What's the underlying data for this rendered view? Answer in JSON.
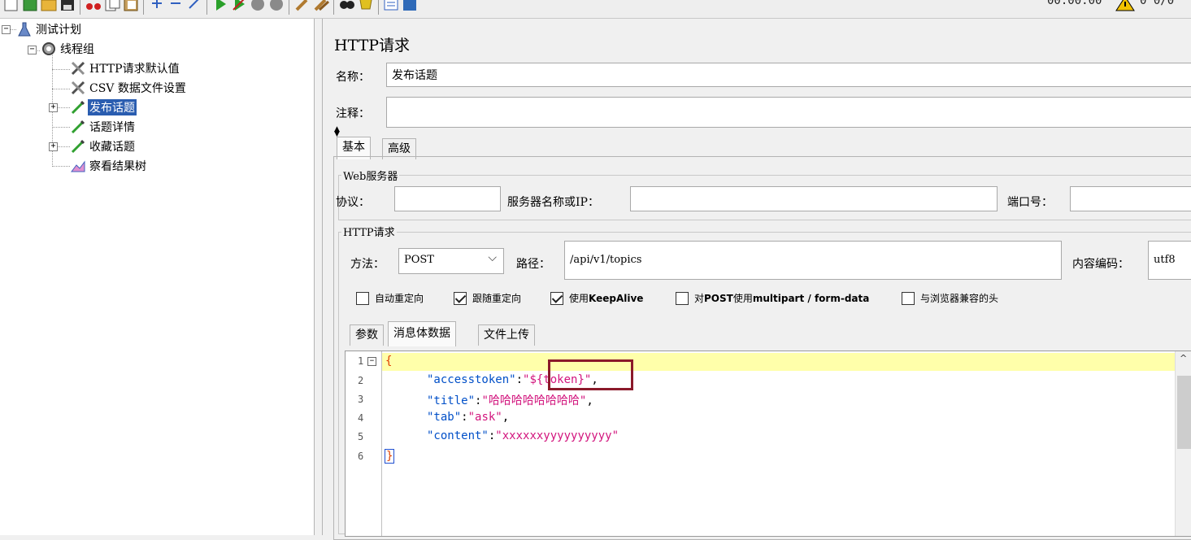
{
  "toolbar": {
    "timer": "00:00:00",
    "counter": "0 0/0",
    "icons": [
      "new-icon",
      "templates-icon",
      "open-icon",
      "save-icon",
      "cut-icon",
      "copy-icon",
      "paste-icon",
      "expand-icon",
      "collapse-icon",
      "toggle-icon",
      "start-icon",
      "start-no-pause-icon",
      "stop-icon",
      "shutdown-icon",
      "clear-icon",
      "clear-all-icon",
      "search-icon",
      "reset-search-icon",
      "function-helper-icon",
      "help-icon"
    ]
  },
  "tree": {
    "items": [
      {
        "label": "测试计划",
        "icon": "test-plan-icon"
      },
      {
        "label": "线程组",
        "icon": "thread-group-icon"
      },
      {
        "label": "HTTP请求默认值",
        "icon": "config-element-icon"
      },
      {
        "label": "CSV 数据文件设置",
        "icon": "config-element-icon"
      },
      {
        "label": "发布话题",
        "icon": "sampler-icon"
      },
      {
        "label": "话题详情",
        "icon": "sampler-icon"
      },
      {
        "label": "收藏话题",
        "icon": "sampler-icon"
      },
      {
        "label": "察看结果树",
        "icon": "listener-icon"
      }
    ]
  },
  "panel": {
    "title": "HTTP请求",
    "name_label": "名称：",
    "name_value": "发布话题",
    "comment_label": "注释：",
    "comment_value": "",
    "tabs": [
      "基本",
      "高级"
    ],
    "web_server": {
      "group_title": "Web服务器",
      "protocol_label": "协议：",
      "protocol_value": "",
      "server_label": "服务器名称或IP：",
      "server_value": "",
      "port_label": "端口号：",
      "port_value": ""
    },
    "http_request": {
      "group_title": "HTTP请求",
      "method_label": "方法：",
      "method_value": "POST",
      "path_label": "路径：",
      "path_value": "/api/v1/topics",
      "encoding_label": "内容编码：",
      "encoding_value": "utf8"
    },
    "checkboxes": [
      {
        "label": "自动重定向",
        "checked": false
      },
      {
        "label": "跟随重定向",
        "checked": true
      },
      {
        "label_prefix": "使用 ",
        "label_bold": "KeepAlive",
        "checked": true
      },
      {
        "label_prefix": "对",
        "label_bold": "POST",
        "label_mid": "使用",
        "label_bold2": "multipart / form-data",
        "checked": false
      },
      {
        "label": "与浏览器兼容的头",
        "checked": false
      }
    ],
    "body_tabs": [
      "参数",
      "消息体数据",
      "文件上传"
    ],
    "body_lines": [
      {
        "num": "1",
        "text": "{"
      },
      {
        "num": "2",
        "key": "\"accesstoken\"",
        "colon": ":",
        "value": "\"${token}\"",
        "comma": ","
      },
      {
        "num": "3",
        "key": "\"title\"",
        "colon": ":",
        "value": "\"哈哈哈哈哈哈哈哈\"",
        "comma": ","
      },
      {
        "num": "4",
        "key": "\"tab\"",
        "colon": ":",
        "value": "\"ask\"",
        "comma": ","
      },
      {
        "num": "5",
        "key": "\"content\"",
        "colon": ":",
        "value": "\"xxxxxxyyyyyyyyyy\"",
        "comma": ""
      },
      {
        "num": "6",
        "text": "}"
      }
    ]
  }
}
